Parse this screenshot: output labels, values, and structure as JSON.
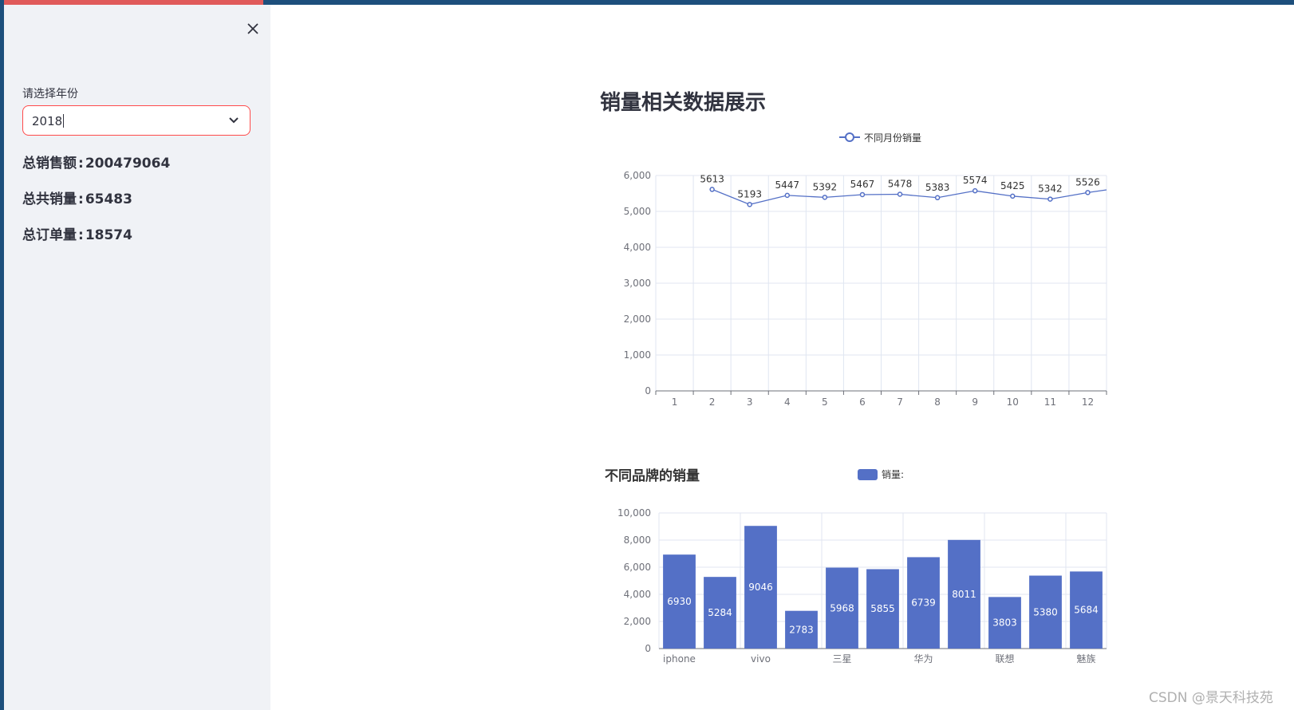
{
  "sidebar": {
    "close_icon": "close-icon",
    "year_label": "请选择年份",
    "year_value": "2018",
    "stats": [
      {
        "label": "总销售额",
        "value": "200479064"
      },
      {
        "label": "总共销量",
        "value": "65483"
      },
      {
        "label": "总订单量",
        "value": "18574"
      }
    ]
  },
  "main": {
    "title": "销量相关数据展示"
  },
  "watermark": "CSDN @景天科技苑",
  "colors": {
    "accent": "#5470c6",
    "sidebar_bg": "#f0f2f6",
    "select_border": "#ff4b4b"
  },
  "chart_data": [
    {
      "type": "line",
      "legend": "不同月份销量",
      "x": [
        "1",
        "2",
        "3",
        "4",
        "5",
        "6",
        "7",
        "8",
        "9",
        "10",
        "11",
        "12"
      ],
      "values": [
        5613,
        5193,
        5447,
        5392,
        5467,
        5478,
        5383,
        5574,
        5425,
        5342,
        5526,
        5600
      ],
      "labels": [
        "5613",
        "5193",
        "5447",
        "5392",
        "5467",
        "5478",
        "5383",
        "5574",
        "5425",
        "5342",
        "5526",
        ""
      ],
      "ylim": [
        0,
        6000
      ],
      "yticks": [
        "0",
        "1,000",
        "2,000",
        "3,000",
        "4,000",
        "5,000",
        "6,000"
      ],
      "grid": true,
      "legend_position": "top-center"
    },
    {
      "type": "bar",
      "title": "不同品牌的销量",
      "legend": "销量:",
      "categories": [
        "iphone",
        "",
        "vivo",
        "",
        "三星",
        "",
        "华为",
        "",
        "联想",
        "",
        "魅族"
      ],
      "values": [
        6930,
        5284,
        9046,
        2783,
        5968,
        5855,
        6739,
        8011,
        3803,
        5380,
        5684
      ],
      "ylim": [
        0,
        10000
      ],
      "yticks": [
        "0",
        "2,000",
        "4,000",
        "6,000",
        "8,000",
        "10,000"
      ],
      "grid": true,
      "legend_position": "top-center"
    }
  ]
}
